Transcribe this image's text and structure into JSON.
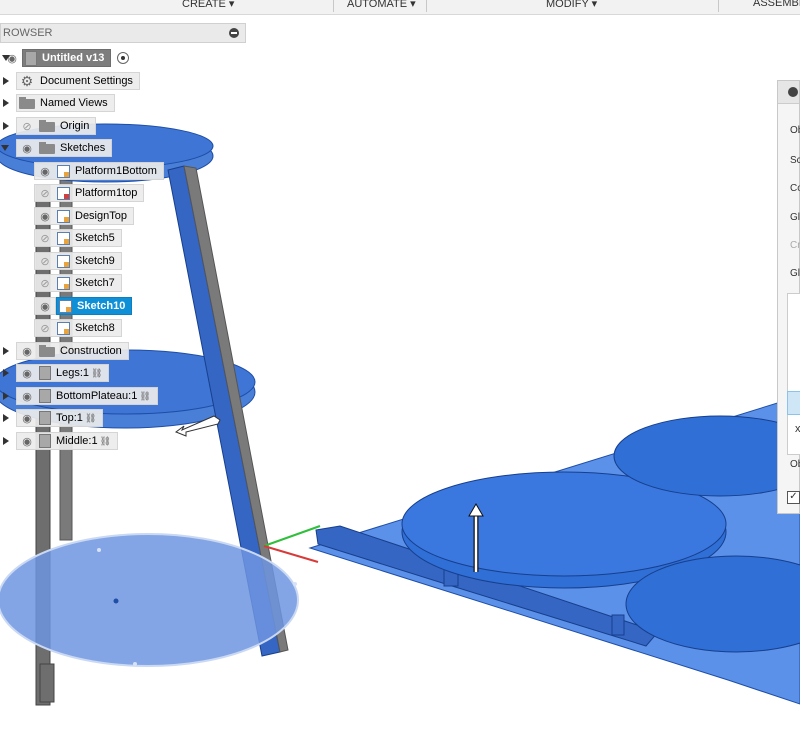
{
  "toolbar": {
    "create": "CREATE ▾",
    "automate": "AUTOMATE ▾",
    "modify": "MODIFY ▾",
    "assemble": "ASSEMBL"
  },
  "browser": {
    "title": "ROWSER",
    "root": "Untitled v13",
    "items": [
      {
        "label": "Document Settings"
      },
      {
        "label": "Named Views"
      },
      {
        "label": "Origin"
      },
      {
        "label": "Sketches"
      },
      {
        "label": "Construction"
      },
      {
        "label": "Legs:1"
      },
      {
        "label": "BottomPlateau:1"
      },
      {
        "label": "Top:1"
      },
      {
        "label": "Middle:1"
      }
    ],
    "sketches": [
      {
        "label": "Platform1Bottom"
      },
      {
        "label": "Platform1top"
      },
      {
        "label": "DesignTop"
      },
      {
        "label": "Sketch5"
      },
      {
        "label": "Sketch9"
      },
      {
        "label": "Sketch7"
      },
      {
        "label": "Sketch10"
      },
      {
        "label": "Sketch8"
      }
    ]
  },
  "panel": {
    "items": [
      "Obj",
      "Sc",
      "Co",
      "Gl",
      "Cr",
      "Gl",
      "Ob"
    ],
    "x_mark": "x",
    "check": "✓"
  },
  "colors": {
    "accent": "#0e8fd6",
    "body_blue": "#2f6fd6"
  }
}
